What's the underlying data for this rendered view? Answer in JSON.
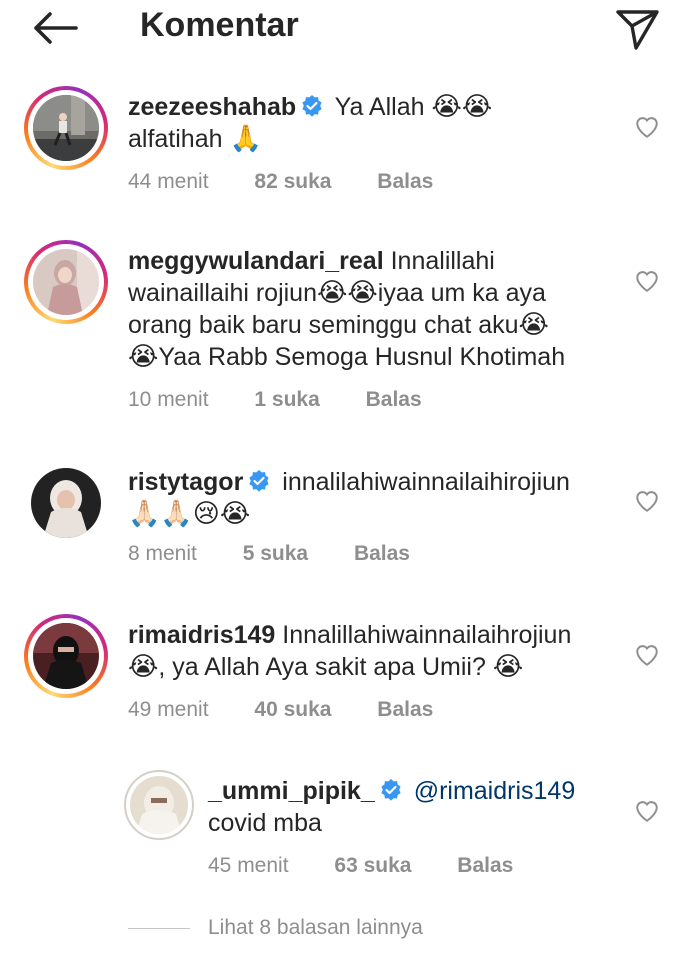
{
  "header": {
    "title": "Komentar"
  },
  "comments": [
    {
      "username": "zeezeeshahab",
      "verified": true,
      "text": "Ya Allah",
      "emojis_inline": "😭😭",
      "text_line2": "alfatihah",
      "emoji_line2": "🙏",
      "time": "44 menit",
      "likes": "82 suka",
      "reply": "Balas"
    },
    {
      "username": "meggywulandari_real",
      "verified": false,
      "line1": "Innalillahi",
      "line2": "wainaillaihi rojiun",
      "line2_emoji": "😭😭",
      "line2_rest": "iyaa um ka aya",
      "line3": "orang baik baru seminggu chat aku",
      "line3_emoji": "😭",
      "line4_emoji": "😭",
      "line4": "Yaa Rabb Semoga Husnul Khotimah",
      "time": "10 menit",
      "likes": "1 suka",
      "reply": "Balas"
    },
    {
      "username": "ristytagor",
      "verified": true,
      "text": "innalilahiwainnailaihirojiun",
      "emojis_line2": "🙏🏻🙏🏻😢😭",
      "time": "8 menit",
      "likes": "5 suka",
      "reply": "Balas"
    },
    {
      "username": "rimaidris149",
      "verified": false,
      "text": "Innalillahiwainnailaihrojiun",
      "line2_emoji": "😭",
      "line2": ", ya Allah Aya sakit apa Umii?",
      "line2_end_emoji": "😭",
      "time": "49 menit",
      "likes": "40 suka",
      "reply": "Balas"
    }
  ],
  "reply_comment": {
    "username": "_ummi_pipik_",
    "verified": true,
    "mention": "@rimaidris149",
    "text": "covid mba",
    "time": "45 menit",
    "likes": "63 suka",
    "reply": "Balas"
  },
  "more_replies": "Lihat 8 balasan lainnya",
  "colors": {
    "text": "#262626",
    "meta": "#8e8e8e",
    "verified": "#3897f0",
    "mention": "#00376b"
  }
}
